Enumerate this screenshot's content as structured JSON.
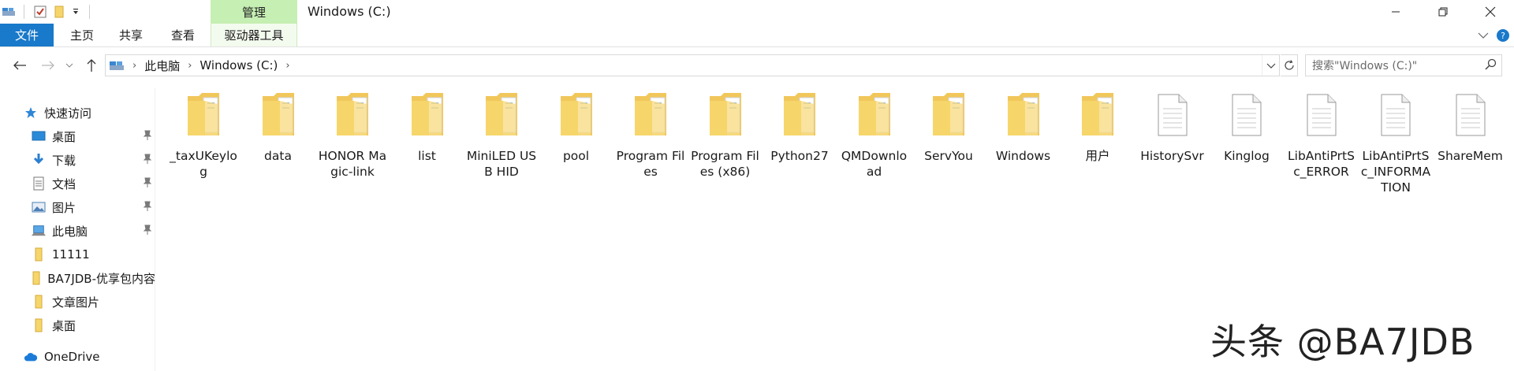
{
  "window": {
    "title": "Windows (C:)"
  },
  "ribbon": {
    "context_group": "管理",
    "tabs": [
      {
        "label": "文件"
      },
      {
        "label": "主页"
      },
      {
        "label": "共享"
      },
      {
        "label": "查看"
      },
      {
        "label": "驱动器工具"
      }
    ]
  },
  "address": {
    "crumbs": [
      "此电脑",
      "Windows (C:)"
    ],
    "search_placeholder": "搜索\"Windows (C:)\""
  },
  "nav": {
    "items": [
      {
        "label": "快速访问",
        "icon": "star-icon"
      },
      {
        "label": "桌面",
        "icon": "desktop-icon",
        "pinned": true
      },
      {
        "label": "下载",
        "icon": "download-icon",
        "pinned": true
      },
      {
        "label": "文档",
        "icon": "document-icon",
        "pinned": true
      },
      {
        "label": "图片",
        "icon": "picture-icon",
        "pinned": true
      },
      {
        "label": "此电脑",
        "icon": "computer-icon",
        "pinned": true
      },
      {
        "label": "11111",
        "icon": "folder-icon"
      },
      {
        "label": "BA7JDB-优享包内容",
        "icon": "folder-icon"
      },
      {
        "label": "文章图片",
        "icon": "folder-icon"
      },
      {
        "label": "桌面",
        "icon": "folder-icon"
      },
      {
        "label": "OneDrive",
        "icon": "cloud-icon"
      }
    ]
  },
  "files": [
    {
      "name": "_taxUKeylog",
      "type": "folder"
    },
    {
      "name": "data",
      "type": "folder"
    },
    {
      "name": "HONOR Magic-link",
      "type": "folder"
    },
    {
      "name": "list",
      "type": "folder"
    },
    {
      "name": "MiniLED USB HID",
      "type": "folder"
    },
    {
      "name": "pool",
      "type": "folder"
    },
    {
      "name": "Program Files",
      "type": "folder"
    },
    {
      "name": "Program Files (x86)",
      "type": "folder"
    },
    {
      "name": "Python27",
      "type": "folder"
    },
    {
      "name": "QMDownload",
      "type": "folder"
    },
    {
      "name": "ServYou",
      "type": "folder"
    },
    {
      "name": "Windows",
      "type": "folder"
    },
    {
      "name": "用户",
      "type": "folder"
    },
    {
      "name": "HistorySvr",
      "type": "file"
    },
    {
      "name": "Kinglog",
      "type": "file"
    },
    {
      "name": "LibAntiPrtSc_ERROR",
      "type": "file"
    },
    {
      "name": "LibAntiPrtSc_INFORMATION",
      "type": "file"
    },
    {
      "name": "ShareMem",
      "type": "file"
    }
  ],
  "watermark": "头条 @BA7JDB",
  "colors": {
    "file_tab": "#1979ca",
    "manage_tab": "#c6efb3",
    "folder": "#f6d66b"
  }
}
